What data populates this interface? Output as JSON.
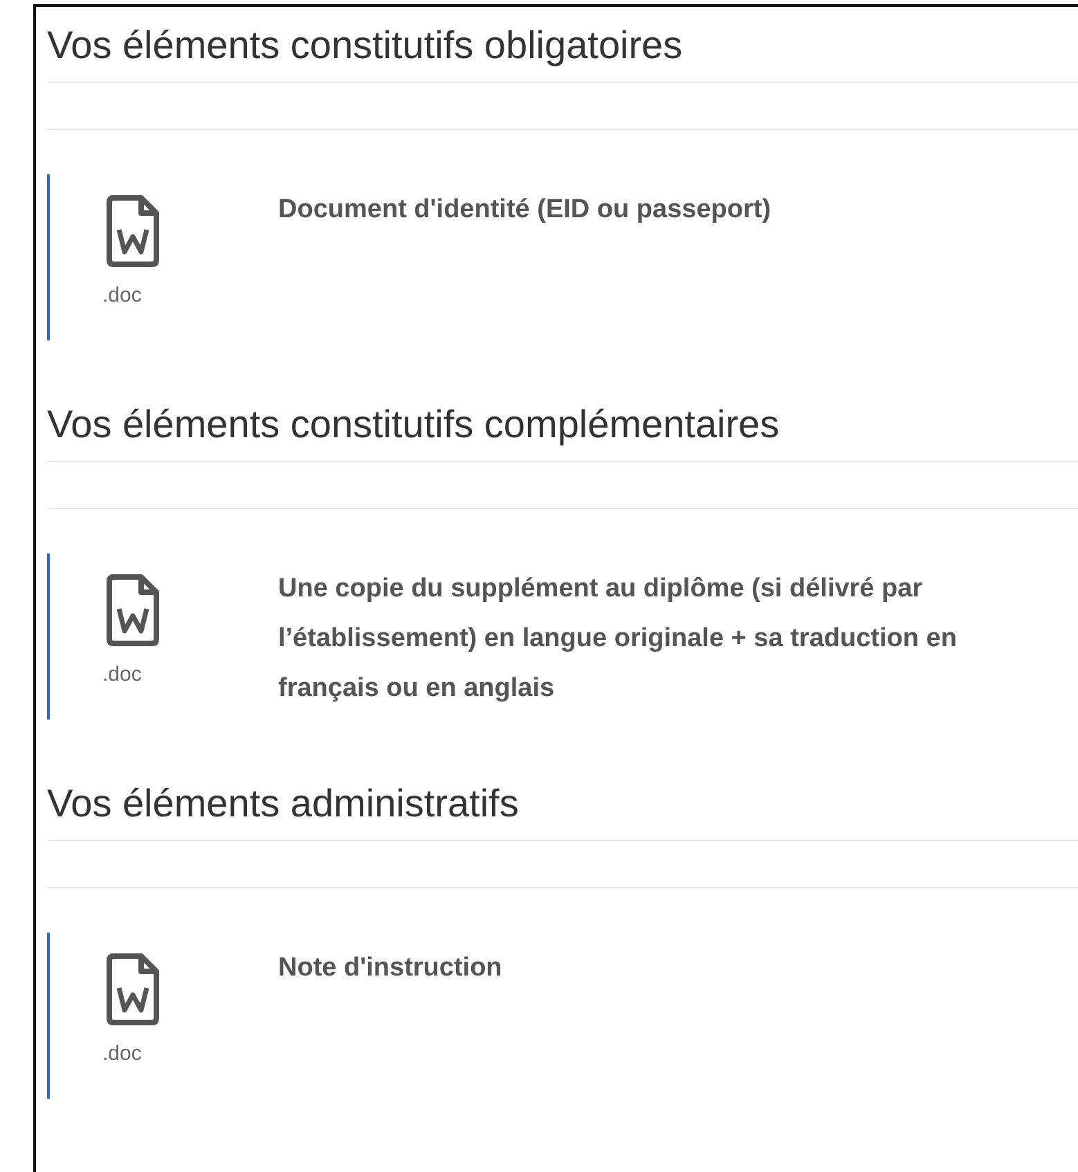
{
  "sections": [
    {
      "title": "Vos éléments constitutifs obligatoires",
      "documents": [
        {
          "extension": ".doc",
          "title": "Document d'identité (EID ou passeport)"
        }
      ]
    },
    {
      "title": "Vos éléments constitutifs complémentaires",
      "documents": [
        {
          "extension": ".doc",
          "title": "Une copie du supplément au diplôme (si délivré par l’établissement) en langue originale + sa traduction en français ou en anglais"
        }
      ]
    },
    {
      "title": "Vos éléments administratifs",
      "documents": [
        {
          "extension": ".doc",
          "title": "Note d'instruction"
        }
      ]
    }
  ]
}
